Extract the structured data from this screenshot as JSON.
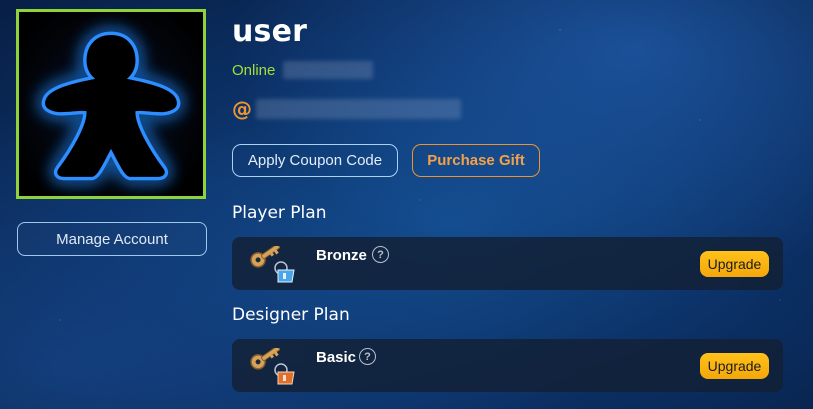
{
  "profile": {
    "username": "user",
    "status": "Online",
    "handle_prefix": "@",
    "avatar_icon": "meeple-icon",
    "avatar_border_color": "#8fd33a"
  },
  "actions": {
    "manage_account": "Manage Account",
    "apply_coupon": "Apply Coupon Code",
    "purchase_gift": "Purchase Gift"
  },
  "player_plan": {
    "title": "Player Plan",
    "tier": "Bronze",
    "help": "?",
    "upgrade": "Upgrade",
    "icon": "bronze-keys-icon"
  },
  "designer_plan": {
    "title": "Designer Plan",
    "tier": "Basic",
    "help": "?",
    "upgrade": "Upgrade",
    "icon": "basic-keys-icon"
  },
  "colors": {
    "accent_green": "#a3e036",
    "accent_orange": "#f0932c",
    "upgrade_yellow": "#ffc21a"
  }
}
